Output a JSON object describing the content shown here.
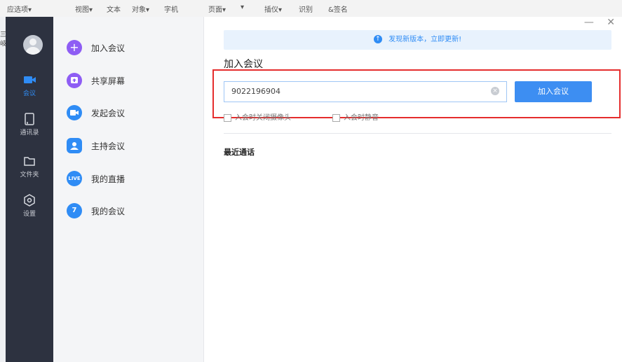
{
  "background_app": {
    "menu_items": [
      "应选项▾",
      "视图▾",
      "文本",
      "对象▾",
      "字机",
      "页面▾",
      "▾",
      "插仪▾",
      "识别",
      "&签名"
    ],
    "left_edge_text": "三岐"
  },
  "rail": {
    "items": [
      {
        "label": "会议",
        "icon": "video-camera-icon",
        "active": true
      },
      {
        "label": "通讯录",
        "icon": "contacts-icon",
        "active": false
      },
      {
        "label": "文件夹",
        "icon": "folder-icon",
        "active": false
      },
      {
        "label": "设置",
        "icon": "settings-icon",
        "active": false
      }
    ]
  },
  "menu": {
    "items": [
      {
        "label": "加入会议",
        "icon": "plus-icon"
      },
      {
        "label": "共享屏幕",
        "icon": "share-screen-icon"
      },
      {
        "label": "发起会议",
        "icon": "video-icon"
      },
      {
        "label": "主持会议",
        "icon": "host-icon"
      },
      {
        "label": "我的直播",
        "icon": "live-icon",
        "icon_text": "LIVE"
      },
      {
        "label": "我的会议",
        "icon": "calendar-icon",
        "icon_text": "7"
      }
    ]
  },
  "window_controls": {
    "minimize": "—",
    "close": "✕"
  },
  "main": {
    "update_banner": "发现新版本，立即更新!",
    "section_title": "加入会议",
    "meeting_code_value": "9022196904",
    "join_button_label": "加入会议",
    "options": [
      {
        "label": "入会时关闭摄像头",
        "checked": false
      },
      {
        "label": "入会时静音",
        "checked": false
      }
    ],
    "recent_title": "最近通话"
  },
  "colors": {
    "accent": "#2f8cf5",
    "rail_bg": "#2d3240",
    "highlight_box": "#e52d2d"
  }
}
